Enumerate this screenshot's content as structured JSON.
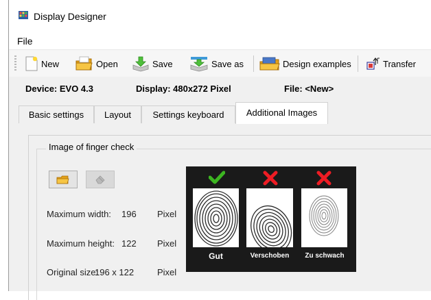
{
  "window": {
    "title": "Display Designer"
  },
  "menu": {
    "file": "File"
  },
  "toolbar": {
    "new": "New",
    "open": "Open",
    "save": "Save",
    "save_as": "Save as",
    "design_examples": "Design examples",
    "transfer": "Transfer"
  },
  "info": {
    "device": "Device: EVO 4.3",
    "display": "Display: 480x272 Pixel",
    "file": "File: <New>"
  },
  "tabs": [
    {
      "label": "Basic settings",
      "active": false
    },
    {
      "label": "Layout",
      "active": false
    },
    {
      "label": "Settings keyboard",
      "active": false
    },
    {
      "label": "Additional Images",
      "active": true
    }
  ],
  "group": {
    "title": "Image of finger check",
    "max_width_label": "Maximum width:",
    "max_width_value": "196",
    "max_height_label": "Maximum height:",
    "max_height_value": "122",
    "original_size_label": "Original size:",
    "original_size_value": "196 x 122",
    "unit": "Pixel"
  },
  "preview": {
    "items": [
      {
        "caption": "Gut",
        "status": "ok"
      },
      {
        "caption": "Verschoben",
        "status": "fail"
      },
      {
        "caption": "Zu schwach",
        "status": "fail"
      }
    ]
  },
  "colors": {
    "check": "#3cb521",
    "cross": "#ee1c24",
    "preview_bg": "#1a1a1a"
  }
}
